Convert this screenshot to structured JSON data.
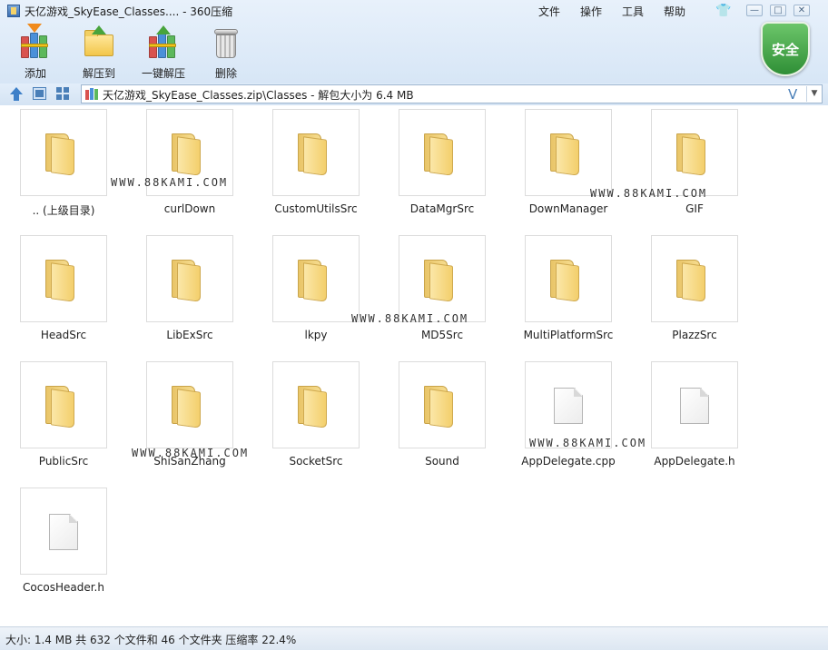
{
  "window": {
    "title": "天亿游戏_SkyEase_Classes.... - 360压缩",
    "menu": [
      "文件",
      "操作",
      "工具",
      "帮助"
    ],
    "skin_icon": "shirt-icon",
    "controls": {
      "minimize": "—",
      "maximize": "□",
      "close": "✕"
    }
  },
  "toolbar": {
    "add": "添加",
    "extract": "解压到",
    "quick_extract": "一键解压",
    "delete": "删除"
  },
  "security_badge": "安全",
  "address": {
    "path": "天亿游戏_SkyEase_Classes.zip\\Classes - 解包大小为 6.4 MB",
    "dropdown_glyph": "V"
  },
  "items": [
    {
      "name": ".. (上级目录)",
      "type": "folder"
    },
    {
      "name": "curlDown",
      "type": "folder"
    },
    {
      "name": "CustomUtilsSrc",
      "type": "folder"
    },
    {
      "name": "DataMgrSrc",
      "type": "folder"
    },
    {
      "name": "DownManager",
      "type": "folder"
    },
    {
      "name": "GIF",
      "type": "folder"
    },
    {
      "name": "HeadSrc",
      "type": "folder"
    },
    {
      "name": "LibExSrc",
      "type": "folder"
    },
    {
      "name": "lkpy",
      "type": "folder"
    },
    {
      "name": "MD5Src",
      "type": "folder"
    },
    {
      "name": "MultiPlatformSrc",
      "type": "folder"
    },
    {
      "name": "PlazzSrc",
      "type": "folder"
    },
    {
      "name": "PublicSrc",
      "type": "folder"
    },
    {
      "name": "ShiSanZhang",
      "type": "folder"
    },
    {
      "name": "SocketSrc",
      "type": "folder"
    },
    {
      "name": "Sound",
      "type": "folder"
    },
    {
      "name": "AppDelegate.cpp",
      "type": "file"
    },
    {
      "name": "AppDelegate.h",
      "type": "file"
    },
    {
      "name": "CocosHeader.h",
      "type": "file"
    }
  ],
  "watermark": "WWW.88KAMI.COM",
  "status": "大小: 1.4 MB 共 632 个文件和 46 个文件夹 压缩率 22.4%"
}
